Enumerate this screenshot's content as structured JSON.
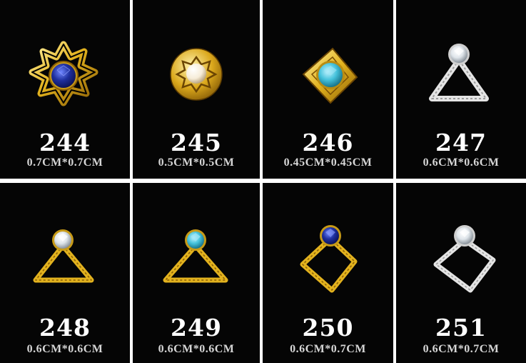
{
  "items": [
    {
      "number": "244",
      "size": "0.7CM*0.7CM",
      "finish": "gold",
      "stone": "sapphire-blue",
      "shape": "star-flower"
    },
    {
      "number": "245",
      "size": "0.5CM*0.5CM",
      "finish": "gold",
      "stone": "pearl",
      "shape": "round-star"
    },
    {
      "number": "246",
      "size": "0.45CM*0.45CM",
      "finish": "gold",
      "stone": "aqua-blue",
      "shape": "square-diamond"
    },
    {
      "number": "247",
      "size": "0.6CM*0.6CM",
      "finish": "silver",
      "stone": "clear-crystal",
      "shape": "triangle"
    },
    {
      "number": "248",
      "size": "0.6CM*0.6CM",
      "finish": "gold",
      "stone": "clear-crystal",
      "shape": "triangle"
    },
    {
      "number": "249",
      "size": "0.6CM*0.6CM",
      "finish": "gold",
      "stone": "aqua-blue",
      "shape": "triangle"
    },
    {
      "number": "250",
      "size": "0.6CM*0.7CM",
      "finish": "gold",
      "stone": "sapphire-blue",
      "shape": "rhombus"
    },
    {
      "number": "251",
      "size": "0.6CM*0.7CM",
      "finish": "silver",
      "stone": "clear-crystal",
      "shape": "rhombus"
    }
  ],
  "colors": {
    "background": "#050505",
    "divider": "#ffffff",
    "gold": "#e2b21e",
    "silver": "#e4e4e4",
    "sapphire": "#1e2f9e",
    "aqua": "#46c3dc",
    "clear": "#eef1f4",
    "pearl": "#f6ecd8"
  }
}
